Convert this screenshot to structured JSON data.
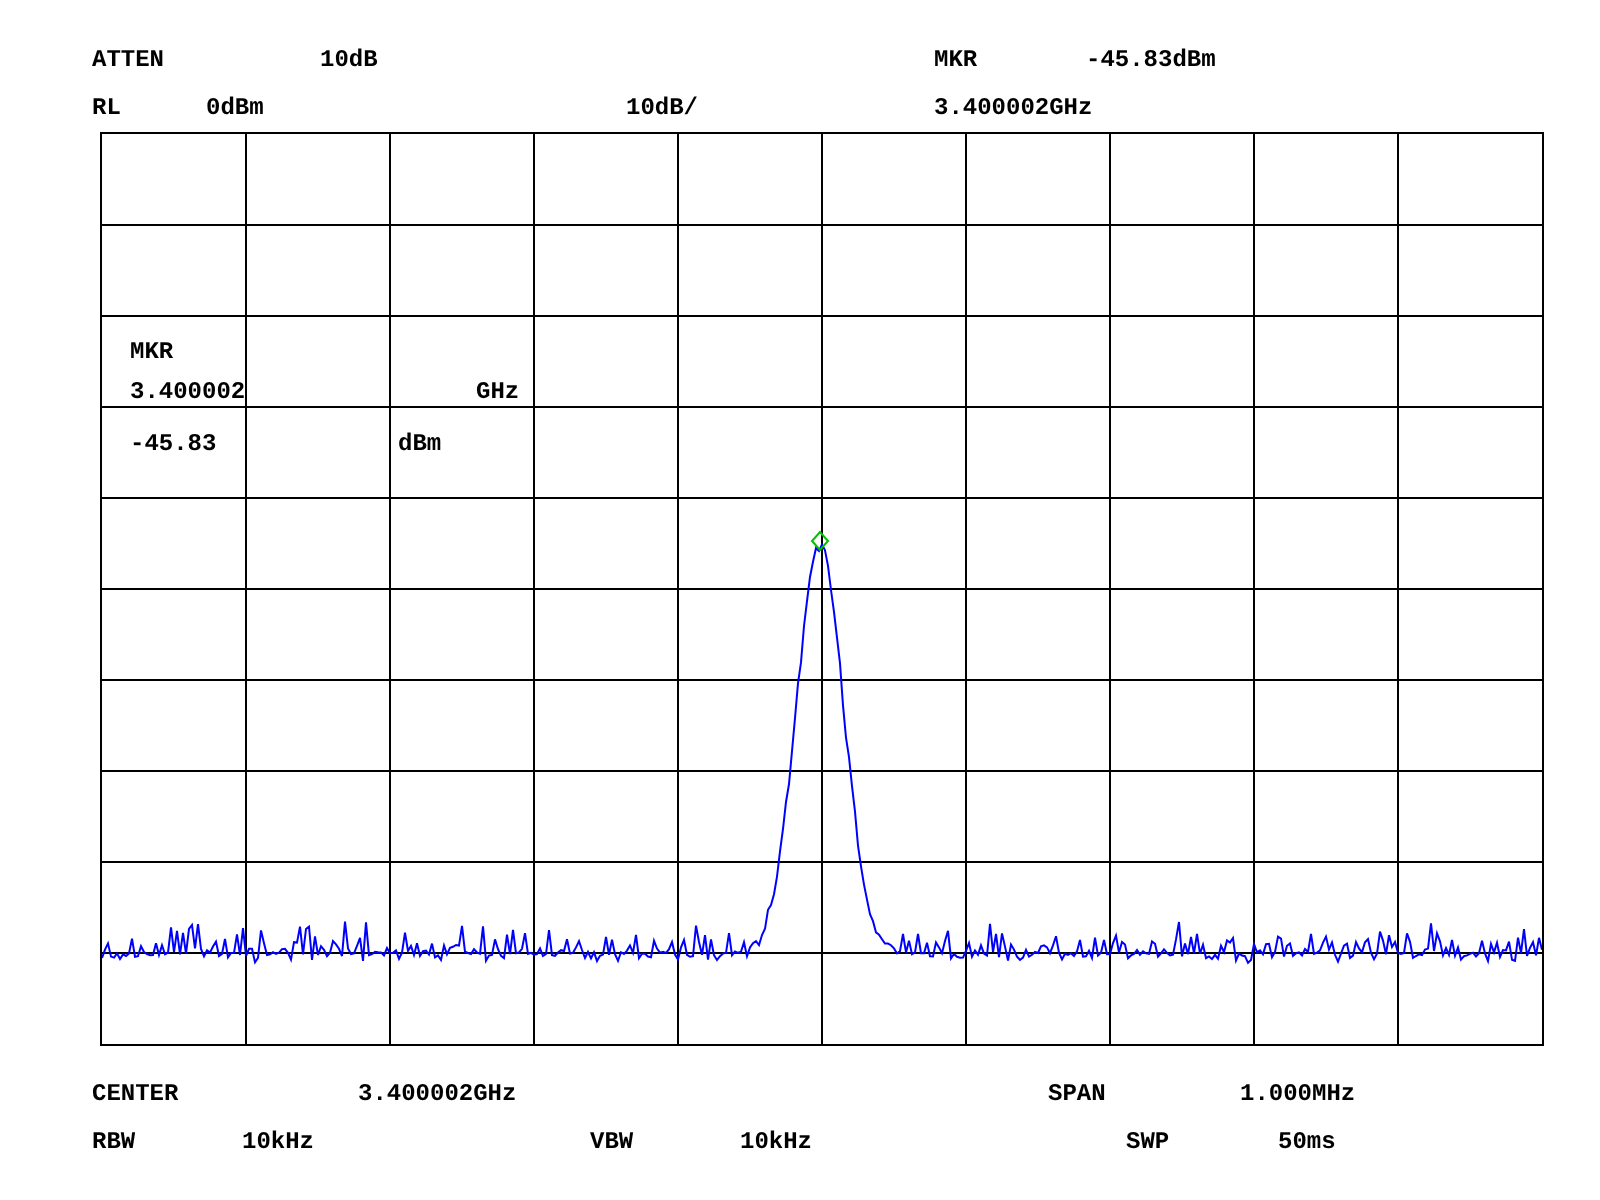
{
  "top_rows": [
    [
      "ATTEN",
      "10dB",
      "MKR",
      "-45.83dBm"
    ],
    [
      "RL",
      "0dBm",
      "10dB/",
      "3.400002GHz"
    ]
  ],
  "marker_readout": {
    "label": "MKR",
    "frequency": "3.400002",
    "frequency_unit": "GHz",
    "amplitude": "-45.83",
    "amplitude_unit": "dBm"
  },
  "bottom_rows": [
    [
      "CENTER",
      "3.400002GHz",
      "SPAN",
      "1.000MHz"
    ],
    [
      "RBW",
      "10kHz",
      "VBW",
      "10kHz",
      "SWP",
      "50ms"
    ]
  ]
}
